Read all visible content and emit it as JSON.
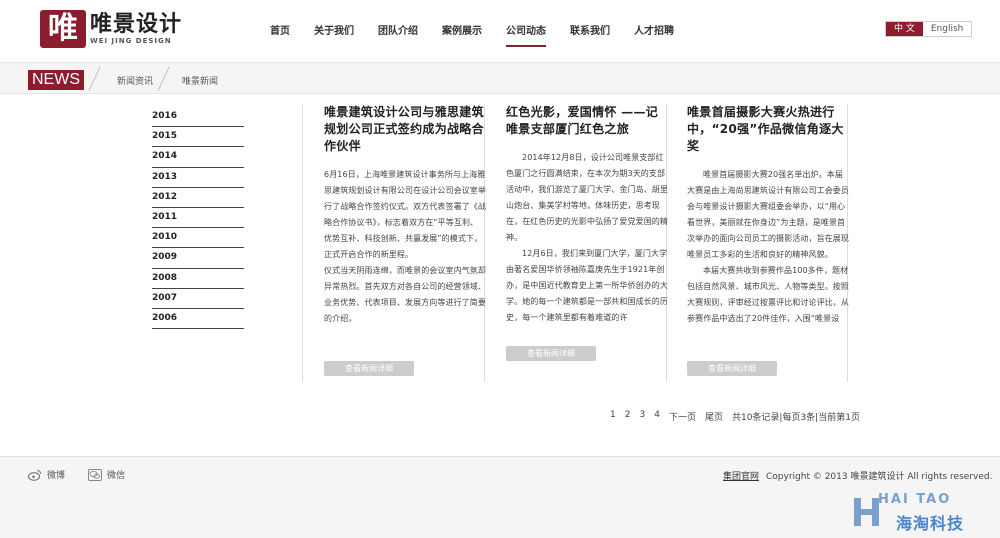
{
  "header": {
    "logo_glyph": "唯",
    "logo_cn": "唯景设计",
    "logo_en": "WEI JING DESIGN",
    "nav": [
      "首页",
      "关于我们",
      "团队介绍",
      "案例展示",
      "公司动态",
      "联系我们",
      "人才招聘"
    ],
    "nav_active_index": 4,
    "lang": {
      "cn": "中 文",
      "en": "English"
    }
  },
  "breadcrumb": {
    "badge": "NEWS",
    "items": [
      "新闻资讯",
      "唯景新闻"
    ]
  },
  "years": [
    "2016",
    "2015",
    "2014",
    "2013",
    "2012",
    "2011",
    "2010",
    "2009",
    "2008",
    "2007",
    "2006"
  ],
  "articles": [
    {
      "title": "唯景建筑设计公司与雅思建筑规划公司正式签约成为战略合作伙伴",
      "paragraphs": [
        "6月16日，上海唯景建筑设计事务所与上海雅思建筑规划设计有限公司在设计公司会议室举行了战略合作签约仪式。双方代表签署了《战略合作协议书》，标志着双方在“平等互利、优势互补、科技创新、共赢发展”的模式下，正式开启合作的新里程。",
        "仪式当天阴雨连绵，而唯景的会议室内气氛却异常热烈。首先双方对各自公司的经营领域、业务优势、代表项目、发展方向等进行了简要的介绍，"
      ],
      "more": "查看新闻详细"
    },
    {
      "title": "红色光影，爱国情怀 ——记唯景支部厦门红色之旅",
      "paragraphs": [
        "2014年12月8日，设计公司唯景支部红色厦门之行圆满结束，在本次为期3天的支部活动中，我们游览了厦门大学、金门岛、胡里山炮台、集美学村等地，体味历史，思考现在，在红色历史的光影中弘扬了爱党爱国的精神。",
        "12月6日，我们来到厦门大学，厦门大学由著名爱国华侨领袖陈嘉庚先生于1921年创办，是中国近代教育史上第一所华侨创办的大学。她的每一个建筑都是一部共和国成长的历史，每一个建筑里都有着难道的许"
      ],
      "more": "查看新闻详细"
    },
    {
      "title": "唯景首届摄影大赛火热进行中，“20强”作品微信角逐大奖",
      "paragraphs": [
        "唯景首届摄影大赛20强名单出炉。本届大赛是由上海尚思建筑设计有限公司工会委员会与唯景设计摄影大赛组委会举办，以“用心看世界，美丽就在你身边”为主题，是唯景首次举办的面向公司员工的摄影活动，旨在展现唯景员工多彩的生活和良好的精神风貌。",
        "本届大赛共收到参赛作品100多件，题材包括自然风景、城市风光、人物等类型。按照大赛规则，评审经过按票评比和讨论评比，从参赛作品中选出了20件佳作，入围“唯景设"
      ],
      "more": "查看新闻详细"
    }
  ],
  "pager": {
    "pages": [
      "1",
      "2",
      "3",
      "4"
    ],
    "next": "下一页",
    "last": "尾页",
    "info": "共10条记录|每页3条|当前第1页"
  },
  "footer": {
    "weibo": "微博",
    "weixin": "微信",
    "group_site": "集团官网",
    "copyright": "Copyright © 2013 唯景建筑设计   All rights reserved.",
    "watermark_en": "HAI TAO",
    "watermark_cn": "海淘科技"
  },
  "colors": {
    "brand": "#8c1d2e",
    "watermark": "#4a86c8"
  }
}
